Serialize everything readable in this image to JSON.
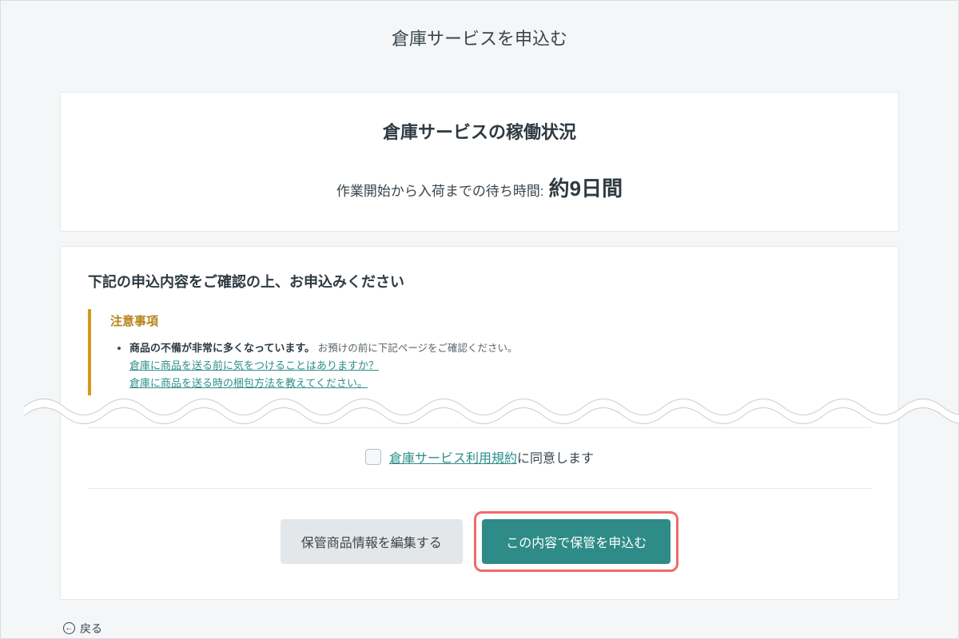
{
  "page": {
    "title": "倉庫サービスを申込む"
  },
  "status": {
    "heading": "倉庫サービスの稼働状況",
    "wait_label": "作業開始から入荷までの待ち時間:",
    "wait_value": "約9日間"
  },
  "confirm": {
    "heading": "下記の申込内容をご確認の上、お申込みください",
    "notice_title": "注意事項",
    "notice_lead": "商品の不備が非常に多くなっています。",
    "notice_sub": "お預けの前に下記ページをご確認ください。",
    "help_links": [
      {
        "label": "倉庫に商品を送る前に気をつけることはありますか？"
      },
      {
        "label": "倉庫に商品を送る時の梱包方法を教えてください。"
      }
    ]
  },
  "agreement": {
    "terms_link_label": "倉庫サービス利用規約",
    "suffix": "に同意します"
  },
  "actions": {
    "edit_label": "保管商品情報を編集する",
    "submit_label": "この内容で保管を申込む"
  },
  "back": {
    "label": "戻る"
  }
}
